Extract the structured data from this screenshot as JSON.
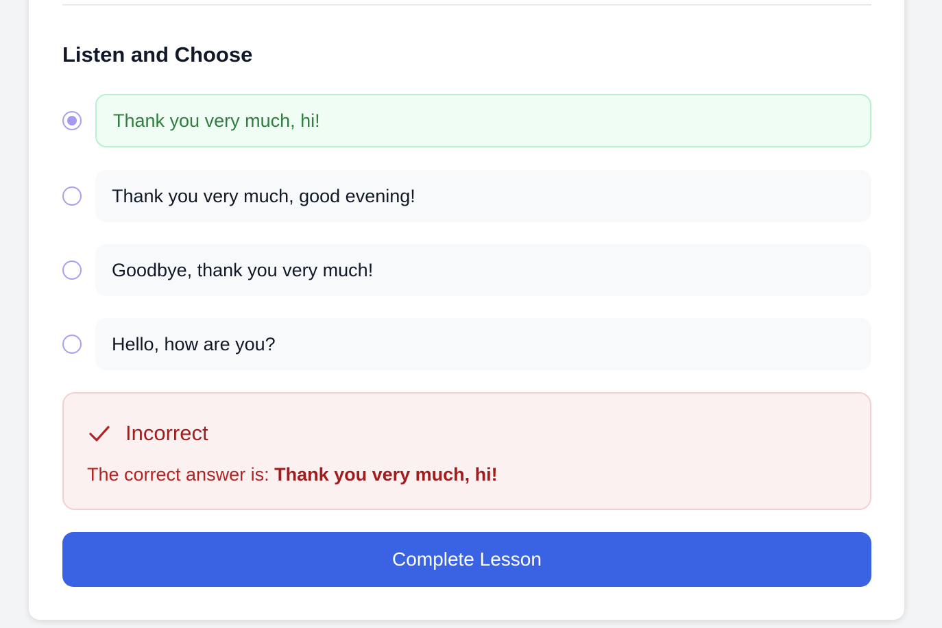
{
  "quiz": {
    "title": "Listen and Choose",
    "selected_index": 0,
    "options": [
      {
        "label": "Thank you very much, hi!"
      },
      {
        "label": "Thank you very much, good evening!"
      },
      {
        "label": "Goodbye, thank you very much!"
      },
      {
        "label": "Hello, how are you?"
      }
    ]
  },
  "feedback": {
    "status": "Incorrect",
    "prefix": "The correct answer is: ",
    "answer": "Thank you very much, hi!",
    "icon": "check-icon"
  },
  "actions": {
    "complete_label": "Complete Lesson"
  },
  "colors": {
    "selected_bg": "#f0fdf4",
    "selected_border": "#bbf0cd",
    "error_bg": "#fcf1f1",
    "error_text": "#b42323",
    "primary": "#3a63e3",
    "radio": "#a5a0f2"
  }
}
